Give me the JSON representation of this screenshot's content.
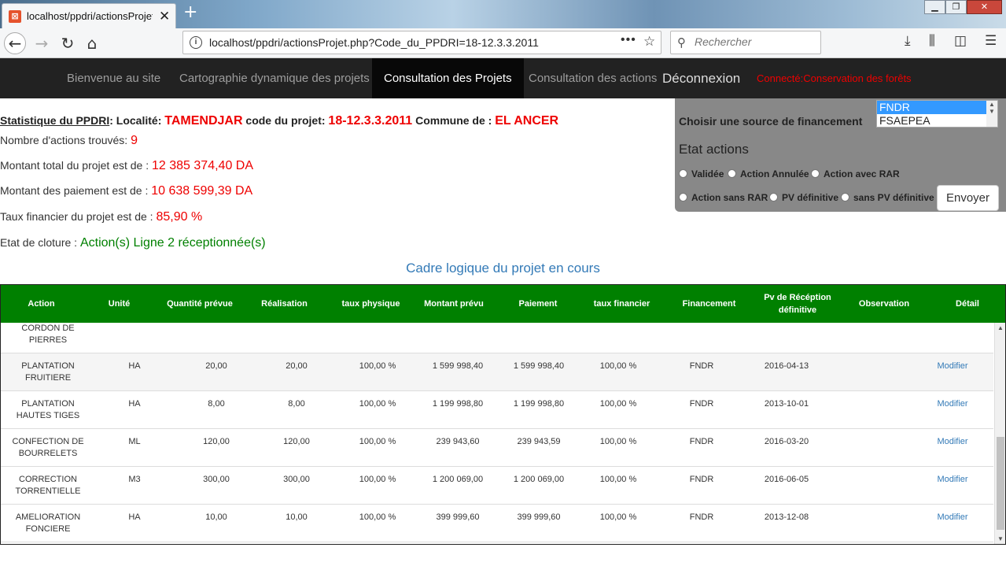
{
  "browser": {
    "tab_title": "localhost/ppdri/actionsProjet.p",
    "url": "localhost/ppdri/actionsProjet.php?Code_du_PPDRI=18-12.3.3.2011",
    "search_placeholder": "Rechercher"
  },
  "nav": {
    "items": [
      "Bienvenue au site",
      "Cartographie dynamique des projets",
      "Consultation des Projets",
      "Consultation des actions"
    ],
    "logout": "Déconnexion",
    "connected": "Connecté:Conservation des forêts"
  },
  "stats": {
    "label_stat": "Statistique du PPDRI",
    "label_localite": ": Localité:",
    "localite": "TAMENDJAR",
    "label_code": "code du projet:",
    "code": "18-12.3.3.2011",
    "label_commune": "Commune de :",
    "commune": "EL ANCER",
    "label_nb": "Nombre d'actions trouvés:",
    "nb": "9",
    "label_montant": "Montant total du projet est de :",
    "montant": "12 385 374,40 DA",
    "label_paiement": "Montant des paiement est de :",
    "paiement": "10 638 599,39 DA",
    "label_taux": "Taux financier du projet est de :",
    "taux": "85,90 %",
    "label_etat": "Etat de cloture :",
    "etat": "Action(s) Ligne 2 réceptionnée(s)"
  },
  "filter": {
    "label": "Choisir une source de financement",
    "options": [
      "FNDR",
      "FSAEPEA"
    ],
    "selected": "FNDR",
    "etat_title": "Etat actions",
    "radios": [
      "Validée",
      "Action Annulée",
      "Action avec RAR",
      "Action sans RAR",
      "PV définitive",
      "sans PV définitive"
    ],
    "submit": "Envoyer"
  },
  "section_title": "Cadre logique du projet en cours",
  "table": {
    "headers": [
      "Action",
      "Unité",
      "Quantité prévue",
      "Réalisation",
      "taux physique",
      "Montant prévu",
      "Paiement",
      "taux financier",
      "Financement",
      "Pv de Récéption définitive",
      "Observation",
      "Détail"
    ],
    "partial_row": {
      "action": "CORDON DE PIERRES"
    },
    "rows": [
      {
        "action": "PLANTATION FRUITIERE",
        "unite": "HA",
        "quantite": "20,00",
        "realisation": "20,00",
        "taux_physique": "100,00 %",
        "montant": "1 599 998,40",
        "paiement": "1 599 998,40",
        "taux_financier": "100,00 %",
        "financement": "FNDR",
        "pv": "2016-04-13",
        "observation": "",
        "detail": "Modifier"
      },
      {
        "action": "PLANTATION HAUTES TIGES",
        "unite": "HA",
        "quantite": "8,00",
        "realisation": "8,00",
        "taux_physique": "100,00 %",
        "montant": "1 199 998,80",
        "paiement": "1 199 998,80",
        "taux_financier": "100,00 %",
        "financement": "FNDR",
        "pv": "2013-10-01",
        "observation": "",
        "detail": "Modifier"
      },
      {
        "action": "CONFECTION DE BOURRELETS",
        "unite": "ML",
        "quantite": "120,00",
        "realisation": "120,00",
        "taux_physique": "100,00 %",
        "montant": "239 943,60",
        "paiement": "239 943,59",
        "taux_financier": "100,00 %",
        "financement": "FNDR",
        "pv": "2016-03-20",
        "observation": "",
        "detail": "Modifier"
      },
      {
        "action": "CORRECTION TORRENTIELLE",
        "unite": "M3",
        "quantite": "300,00",
        "realisation": "300,00",
        "taux_physique": "100,00 %",
        "montant": "1 200 069,00",
        "paiement": "1 200 069,00",
        "taux_financier": "100,00 %",
        "financement": "FNDR",
        "pv": "2016-06-05",
        "observation": "",
        "detail": "Modifier"
      },
      {
        "action": "AMELIORATION FONCIERE",
        "unite": "HA",
        "quantite": "10,00",
        "realisation": "10,00",
        "taux_physique": "100,00 %",
        "montant": "399 999,60",
        "paiement": "399 999,60",
        "taux_financier": "100,00 %",
        "financement": "FNDR",
        "pv": "2013-12-08",
        "observation": "",
        "detail": "Modifier"
      }
    ]
  },
  "colors": {
    "nav_bg": "#222222",
    "header_green": "#008000",
    "accent_red": "#e00000",
    "link_blue": "#337ab7"
  }
}
